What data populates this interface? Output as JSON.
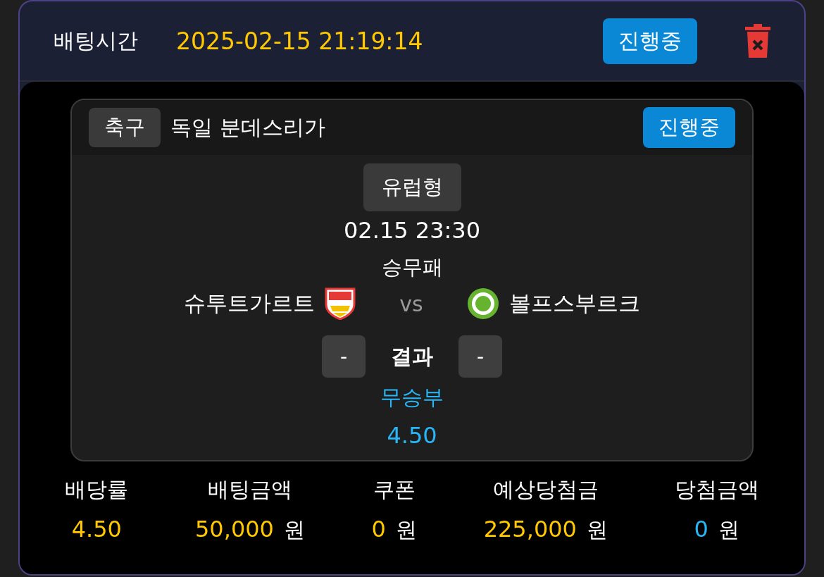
{
  "header": {
    "label": "배팅시간",
    "time": "2025-02-15 21:19:14",
    "status": "진행중"
  },
  "match": {
    "sport": "축구",
    "league": "독일 분데스리가",
    "status": "진행중",
    "market_type": "유럽형",
    "kickoff": "02.15 23:30",
    "bet_type": "승무패",
    "home": {
      "name": "슈투트가르트"
    },
    "vs": "vs",
    "away": {
      "name": "볼프스부르크"
    },
    "home_score": "-",
    "result_label": "결과",
    "away_score": "-",
    "pick": "무승부",
    "odds": "4.50"
  },
  "stats": [
    {
      "label": "배당률",
      "value": "4.50",
      "color": "#ffc800"
    },
    {
      "label": "배팅금액",
      "value": "50,000",
      "unit": "원",
      "color": "#ffc800"
    },
    {
      "label": "쿠폰",
      "value": "0",
      "unit": "원",
      "color": "#ffc800"
    },
    {
      "label": "예상당첨금",
      "value": "225,000",
      "unit": "원",
      "color": "#ffc800"
    },
    {
      "label": "당첨금액",
      "value": "0",
      "unit": "원",
      "color": "#29b6f6"
    }
  ]
}
